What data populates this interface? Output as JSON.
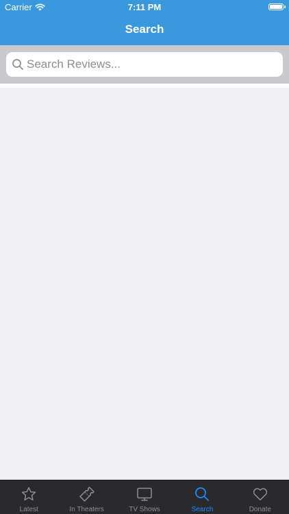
{
  "status_bar": {
    "carrier": "Carrier",
    "time": "7:11 PM"
  },
  "nav": {
    "title": "Search"
  },
  "search": {
    "placeholder": "Search Reviews...",
    "value": ""
  },
  "tabs": [
    {
      "label": "Latest",
      "icon": "star-icon",
      "active": false
    },
    {
      "label": "In Theaters",
      "icon": "ticket-icon",
      "active": false
    },
    {
      "label": "TV Shows",
      "icon": "tv-icon",
      "active": false
    },
    {
      "label": "Search",
      "icon": "search-icon",
      "active": true
    },
    {
      "label": "Donate",
      "icon": "heart-icon",
      "active": false
    }
  ],
  "colors": {
    "nav_background": "#3a98dc",
    "search_bar_background": "#c9c9ce",
    "content_background": "#efeff4",
    "tabbar_background": "#2a2a2c",
    "tab_active": "#1a8cff",
    "tab_inactive": "#8e8e93"
  }
}
